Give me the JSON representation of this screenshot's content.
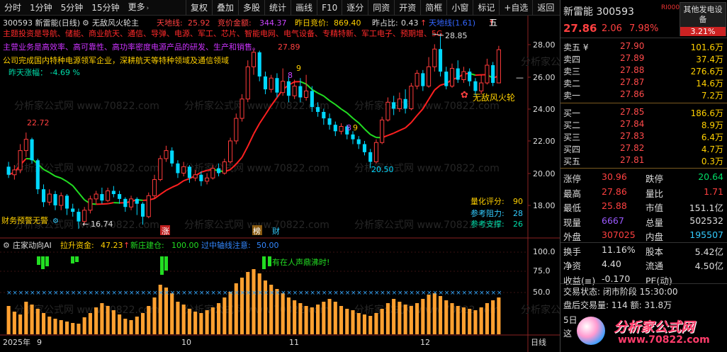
{
  "toolbar": {
    "left_items": [
      {
        "label": "分时"
      },
      {
        "label": "1分钟"
      },
      {
        "label": "5分钟"
      },
      {
        "label": "15分钟"
      },
      {
        "label": "更多"
      }
    ],
    "more_caret": "›",
    "right_items": [
      {
        "label": "复权"
      },
      {
        "label": "叠加"
      },
      {
        "label": "多股"
      },
      {
        "label": "统计"
      },
      {
        "label": "画线"
      },
      {
        "label": "F10"
      },
      {
        "label": "逐分"
      },
      {
        "label": "同资"
      },
      {
        "label": "开资"
      },
      {
        "label": "简框"
      },
      {
        "label": "小窗"
      },
      {
        "label": "标记"
      },
      {
        "label": "+自选"
      },
      {
        "label": "返回"
      }
    ]
  },
  "main_panel": {
    "header": {
      "code_name": "300593 新雷能(日线)",
      "indicator": "无敌风火轮主",
      "tiandi_label": "天地线:",
      "tiandi_value": "25.92",
      "jingjia_label": "竞价金额:",
      "jingjia_value": "344.37",
      "zuori_label": "昨日竞价:",
      "zuori_value": "869.40",
      "zuobi_label": "昨占比:",
      "zuobi_value": "0.43"
    },
    "tags_line": "主题投资是导航、储能、商业航天、通信、导弹、电源、军工、芯片、智能电网、电气设备、专精特新、军工电子、预期增、5G",
    "business_line": "主营业务是高效率、高可靠性、高功率密度电源产品的研发、生产和销售。",
    "company_line": "公司完成国内特种电源领军企业，深耕航天等特种领域及通信领域",
    "yesterday_change": "昨天涨幅： -4.69 %",
    "price_labels": {
      "high": "27.89",
      "peak": "28.85",
      "left_high": "22.72",
      "mid_low": "20.50",
      "left_low": "16.74"
    },
    "digit_marks": [
      "9",
      "8",
      "9",
      "8",
      "9",
      "5"
    ],
    "wudi_label": "无敌风火轮",
    "event_tags": [
      "涨",
      "榜",
      "财"
    ],
    "left_note": "财务预警无警",
    "left_note_icon": "⚙",
    "right_info": {
      "score_label": "量化评分:",
      "score_value": "90",
      "resist_label": "参考阻力:",
      "resist_value": "28",
      "support_label": "参考支撑:",
      "support_value": "26"
    },
    "topright_overlay": "天地线(1.61)",
    "topright_marker": "五",
    "right_axis": [
      "28.00",
      "26.00",
      "24.00",
      "22.00",
      "20.00",
      "18.00"
    ]
  },
  "sub_panel": {
    "title": "庄家动向AI",
    "lasheng_label": "拉升资金:",
    "lasheng_value": "47.23",
    "xinzhuang_label": "新庄建仓:",
    "xinzhuang_value": "100.00",
    "guozhong_label": "过中轴线注意:",
    "guozhong_value": "50.00",
    "alert": "有在人声鼎沸时!",
    "right_axis": [
      "100.0",
      "75.0",
      "50.0"
    ]
  },
  "xaxis": {
    "labels": [
      "2025年",
      "9",
      "10",
      "11",
      "12"
    ],
    "right_label": "日线"
  },
  "stock": {
    "name": "新雷能",
    "code": "300593",
    "badge": "RI000",
    "price": "27.86",
    "change": "2.06",
    "percent": "7.98%",
    "sector_name": "其他发电设备",
    "sector_percent": "3.21%"
  },
  "order_book": {
    "asks": [
      {
        "label": "卖五 ¥",
        "price": "27.90",
        "vol": "101.6万"
      },
      {
        "label": "卖四",
        "price": "27.89",
        "vol": "37.4万"
      },
      {
        "label": "卖三",
        "price": "27.88",
        "vol": "276.6万"
      },
      {
        "label": "卖二",
        "price": "27.87",
        "vol": "14.6万"
      },
      {
        "label": "卖一",
        "price": "27.86",
        "vol": "7.2万"
      }
    ],
    "bids": [
      {
        "label": "买一",
        "price": "27.85",
        "vol": "186.6万"
      },
      {
        "label": "买二",
        "price": "27.84",
        "vol": "8.9万"
      },
      {
        "label": "买三",
        "price": "27.83",
        "vol": "6.4万"
      },
      {
        "label": "买四",
        "price": "27.82",
        "vol": "4.7万"
      },
      {
        "label": "买五",
        "price": "27.81",
        "vol": "0.3万"
      }
    ]
  },
  "quote": [
    {
      "l1": "涨停",
      "v1": "30.96",
      "c1": "#ff4040",
      "l2": "跌停",
      "v2": "20.64",
      "c2": "#00dd66"
    },
    {
      "l1": "最高",
      "v1": "27.86",
      "c1": "#ff4040",
      "l2": "量比",
      "v2": "1.71",
      "c2": "#ff4040"
    },
    {
      "l1": "最低",
      "v1": "25.88",
      "c1": "#ff4040",
      "l2": "市值",
      "v2": "151.1亿",
      "c2": "#dddddd"
    },
    {
      "l1": "现量",
      "v1": "6667",
      "c1": "#9b59ff",
      "l2": "总量",
      "v2": "502532",
      "c2": "#dddddd"
    },
    {
      "l1": "外盘",
      "v1": "307025",
      "c1": "#ff4040",
      "l2": "内盘",
      "v2": "195507",
      "c2": "#33ccff"
    },
    {
      "l1": "换手",
      "v1": "11.16%",
      "c1": "#dddddd",
      "l2": "股本",
      "v2": "5.42亿",
      "c2": "#dddddd"
    },
    {
      "l1": "净资",
      "v1": "4.40",
      "c1": "#dddddd",
      "l2": "流通",
      "v2": "4.50亿",
      "c2": "#dddddd"
    },
    {
      "l1": "收益(≡)",
      "v1": "-0.170",
      "c1": "#dddddd",
      "l2": "PE(动)",
      "v2": "",
      "c2": "#dddddd"
    }
  ],
  "status": {
    "trade_state": "交易状态: 闭市阶段 15:30:00",
    "after_hours": "盘后交易量: 114  额: 31.8万",
    "row5": "5日",
    "row_last": "这"
  },
  "logo": {
    "name": "分析家公式网",
    "url": "www.70822.com"
  },
  "watermark": "分析家公式网 www.70822.com",
  "colors": {
    "up": "#ff3b3b",
    "down": "#00d8ff",
    "ma_red": "#ff2020",
    "ma_green": "#22dd22",
    "bar": "#ffa030",
    "text_yellow": "#ffd000"
  }
}
